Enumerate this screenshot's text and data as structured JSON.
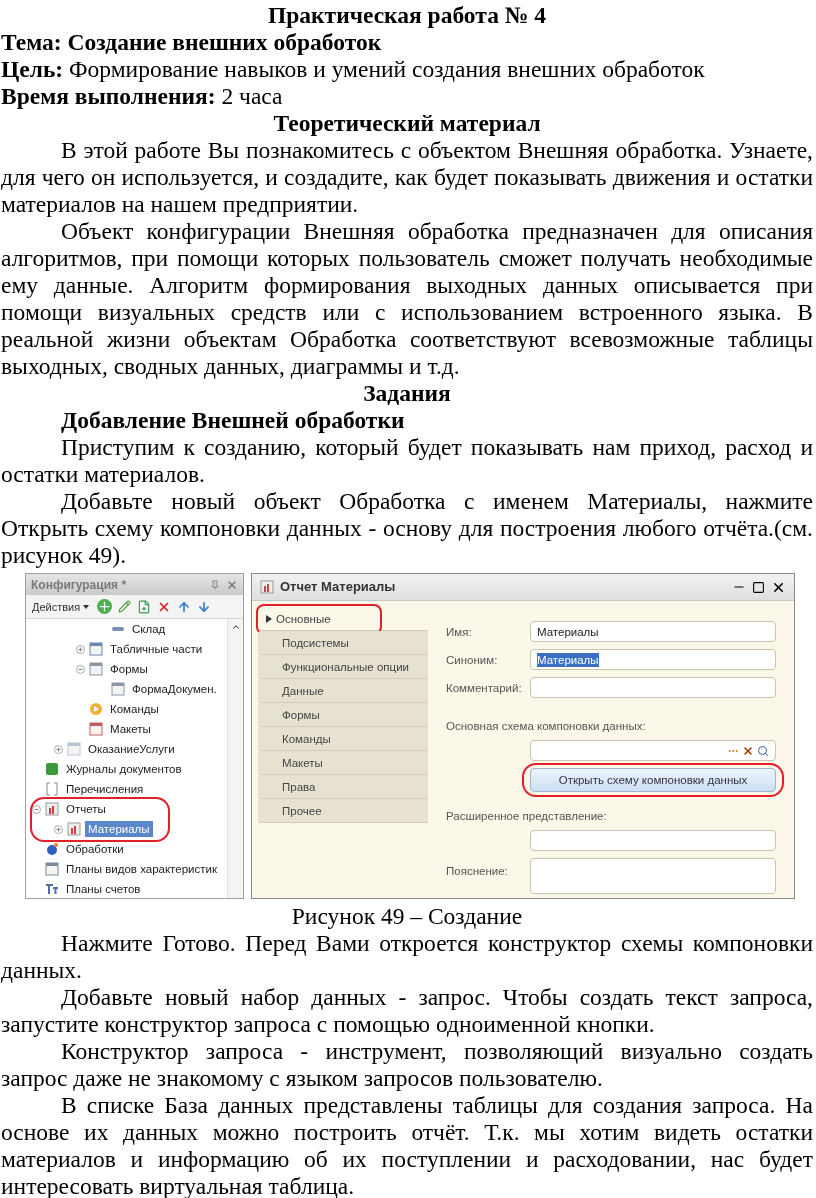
{
  "title": "Практическая работа № 4",
  "topic": {
    "label": "Тема:",
    "value": "Создание внешних обработок"
  },
  "goal": {
    "label": "Цель:",
    "value": "Формирование навыков и умений создания внешних обработок"
  },
  "duration": {
    "label": "Время выполнения:",
    "value": "2 часа"
  },
  "theory": {
    "heading": "Теоретический материал",
    "paragraphs": [
      "В этой работе Вы познакомитесь с объектом Внешняя обработка. Узнаете, для чего он используется, и создадите, как будет показывать движения и остатки материалов на нашем предприятии.",
      "Объект конфигурации Внешняя обработка предназначен для описания алгоритмов, при помощи которых пользователь сможет получать необходимые ему данные. Алгоритм формирования выходных данных описывается при помощи визуальных средств или с использованием встроенного языка. В реальной жизни объектам Обработка соответствуют всевозможные таблицы выходных, сводных данных, диаграммы и т.д."
    ]
  },
  "tasks": {
    "heading": "Задания",
    "subheading": "Добавление Внешней обработки",
    "paragraphs": [
      "Приступим к созданию, который будет показывать нам приход, расход и остатки материалов.",
      "Добавьте новый объект Обработка с именем Материалы, нажмите Открыть схему компоновки данных - основу для построения любого отчёта.(см. рисунок 49)."
    ]
  },
  "figure": {
    "config_panel": {
      "title": "Конфигурация *",
      "actions": "Действия",
      "tree": [
        {
          "children": [
            {
              "children": [
                {
                  "children": [
                    {
                      "label": "Склад",
                      "kind": "attribute"
                    }
                  ]
                },
                {
                  "label": "Табличные части",
                  "kind": "table",
                  "expanded": false
                },
                {
                  "label": "Формы",
                  "kind": "form",
                  "expanded": true,
                  "children": [
                    {
                      "label": "ФормаДокумен.",
                      "kind": "form"
                    }
                  ]
                },
                {
                  "label": "Команды",
                  "kind": "command"
                },
                {
                  "label": "Макеты",
                  "kind": "layout"
                }
              ]
            },
            {
              "label": "ОказаниеУслуги",
              "kind": "document",
              "expanded": false
            }
          ]
        },
        {
          "label": "Журналы документов",
          "kind": "journal"
        },
        {
          "label": "Перечисления",
          "kind": "enum"
        },
        {
          "label": "Отчеты",
          "kind": "report",
          "expanded": true,
          "highlighted": true,
          "children": [
            {
              "label": "Материалы",
              "kind": "report",
              "expanded": false,
              "selected": true
            }
          ]
        },
        {
          "label": "Обработки",
          "kind": "processing"
        },
        {
          "label": "Планы видов характеристик",
          "kind": "chart"
        },
        {
          "label": "Планы счетов",
          "kind": "accounts"
        }
      ]
    },
    "window": {
      "title": "Отчет Материалы",
      "tabs": [
        {
          "label": "Основные",
          "selected": true,
          "highlighted": true
        },
        {
          "label": "Подсистемы",
          "selected": false,
          "highlighted": false
        },
        {
          "label": "Функциональные опции",
          "selected": false,
          "highlighted": false
        },
        {
          "label": "Данные",
          "selected": false,
          "highlighted": false
        },
        {
          "label": "Формы",
          "selected": false,
          "highlighted": false
        },
        {
          "label": "Команды",
          "selected": false,
          "highlighted": false
        },
        {
          "label": "Макеты",
          "selected": false,
          "highlighted": false
        },
        {
          "label": "Права",
          "selected": false,
          "highlighted": false
        },
        {
          "label": "Прочее",
          "selected": false,
          "highlighted": false
        }
      ],
      "fields": [
        {
          "kind": "inline",
          "label": "Имя:",
          "value": "Материалы",
          "text_selected": false
        },
        {
          "kind": "inline",
          "label": "Синоним:",
          "value": "Материалы",
          "text_selected": true
        },
        {
          "kind": "inline",
          "label": "Комментарий:"
        },
        {
          "kind": "picker",
          "label": "Основная схема компоновки данных:"
        },
        {
          "kind": "button",
          "label": "Открыть схему компоновки данных",
          "highlighted": true
        },
        {
          "kind": "stacked",
          "label": "Расширенное представление:"
        },
        {
          "kind": "area",
          "label": "Пояснение:"
        }
      ]
    }
  },
  "caption": "Рисунок 49 – Создание",
  "after": [
    "Нажмите Готово. Перед Вами откроется конструктор схемы компоновки данных.",
    "Добавьте новый набор данных - запрос. Чтобы создать текст запроса, запустите конструктор запроса с помощью одноименной кнопки.",
    "Конструктор запроса - инструмент, позволяющий визуально создать запрос даже не знакомому с языком запросов пользователю.",
    "В списке База данных представлены таблицы для создания запроса. На основе их данных можно построить отчёт. Т.к. мы хотим видеть остатки материалов и информацию об их поступлении и расходовании, нас будет интересовать виртуальная таблица."
  ]
}
